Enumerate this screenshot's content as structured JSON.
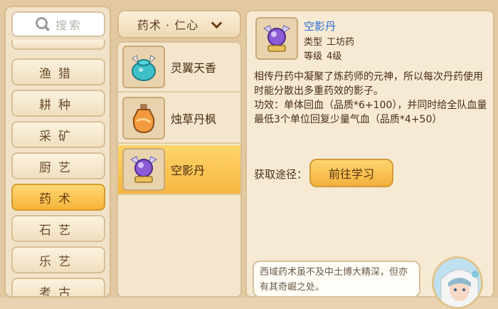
{
  "search": {
    "placeholder": "搜索"
  },
  "categories": [
    {
      "label": "渔猎"
    },
    {
      "label": "耕种"
    },
    {
      "label": "采矿"
    },
    {
      "label": "厨艺"
    },
    {
      "label": "药术"
    },
    {
      "label": "石艺"
    },
    {
      "label": "乐艺"
    },
    {
      "label": "考古"
    }
  ],
  "dropdown": {
    "label": "药术 · 仁心"
  },
  "items": [
    {
      "name": "灵翼天香",
      "icon": "blue-winged-pot-icon"
    },
    {
      "name": "烛草丹枫",
      "icon": "orange-potion-bottle-icon"
    },
    {
      "name": "空影丹",
      "icon": "purple-orb-pill-icon"
    }
  ],
  "detail": {
    "name": "空影丹",
    "type_label": "类型",
    "type_value": "工坊药",
    "level_label": "等级",
    "level_value": "4级",
    "description": "相传丹药中凝聚了炼药师的元神，所以每次丹药使用时能分散出多重药效的影子。",
    "effect": "功效：单体回血（品质*6+100），并同时给全队血量最低3个单位回复少量气血（品质*4+50）",
    "obtain_label": "获取途径：",
    "obtain_button": "前往学习"
  },
  "npc": {
    "dialogue": "西域药术虽不及中土博大精深，但亦有其奇崛之处。"
  },
  "colors": {
    "accent": "#f6b43b",
    "link": "#2f6fd6",
    "panel": "#f6ead4"
  }
}
